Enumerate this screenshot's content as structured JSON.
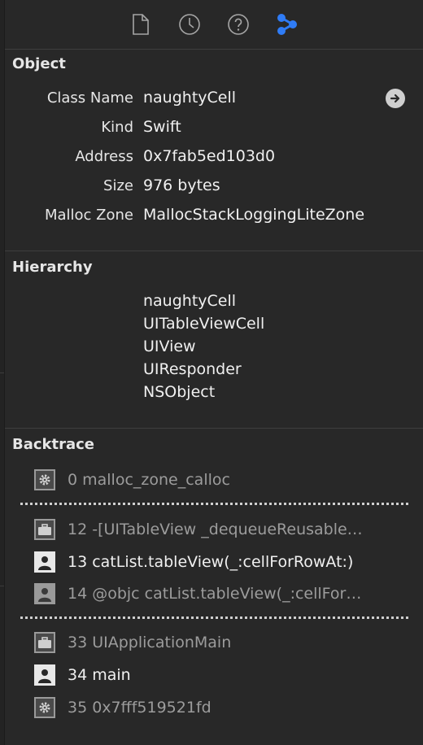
{
  "toolbar": {
    "icons": [
      "file-inspector-icon",
      "history-icon",
      "help-icon",
      "memory-graph-icon"
    ]
  },
  "object": {
    "title": "Object",
    "rows": [
      {
        "label": "Class Name",
        "value": "naughtyCell"
      },
      {
        "label": "Kind",
        "value": "Swift"
      },
      {
        "label": "Address",
        "value": "0x7fab5ed103d0"
      },
      {
        "label": "Size",
        "value": "976 bytes"
      },
      {
        "label": "Malloc Zone",
        "value": "MallocStackLoggingLiteZone"
      }
    ]
  },
  "hierarchy": {
    "title": "Hierarchy",
    "items": [
      "naughtyCell",
      "UITableViewCell",
      "UIView",
      "UIResponder",
      "NSObject"
    ]
  },
  "backtrace": {
    "title": "Backtrace",
    "frames": [
      {
        "text": "0 malloc_zone_calloc",
        "icon": "gear-icon",
        "state": "dim"
      },
      {
        "text": "12 -[UITableView _dequeueReusable…",
        "icon": "briefcase-icon",
        "state": "dim"
      },
      {
        "text": "13 catList.tableView(_:cellForRowAt:)",
        "icon": "user-icon",
        "state": "bright"
      },
      {
        "text": "14 @objc catList.tableView(_:cellFor…",
        "icon": "user-icon",
        "state": "dim"
      },
      {
        "text": "33 UIApplicationMain",
        "icon": "briefcase-icon",
        "state": "dim"
      },
      {
        "text": "34 main",
        "icon": "user-icon",
        "state": "bright"
      },
      {
        "text": "35 0x7fff519521fd",
        "icon": "gear-icon",
        "state": "dim"
      }
    ]
  },
  "colors": {
    "background": "#282828",
    "accent": "#2f7cf6",
    "text": "#e6e6e6",
    "dim_text": "#9c9c9c"
  }
}
